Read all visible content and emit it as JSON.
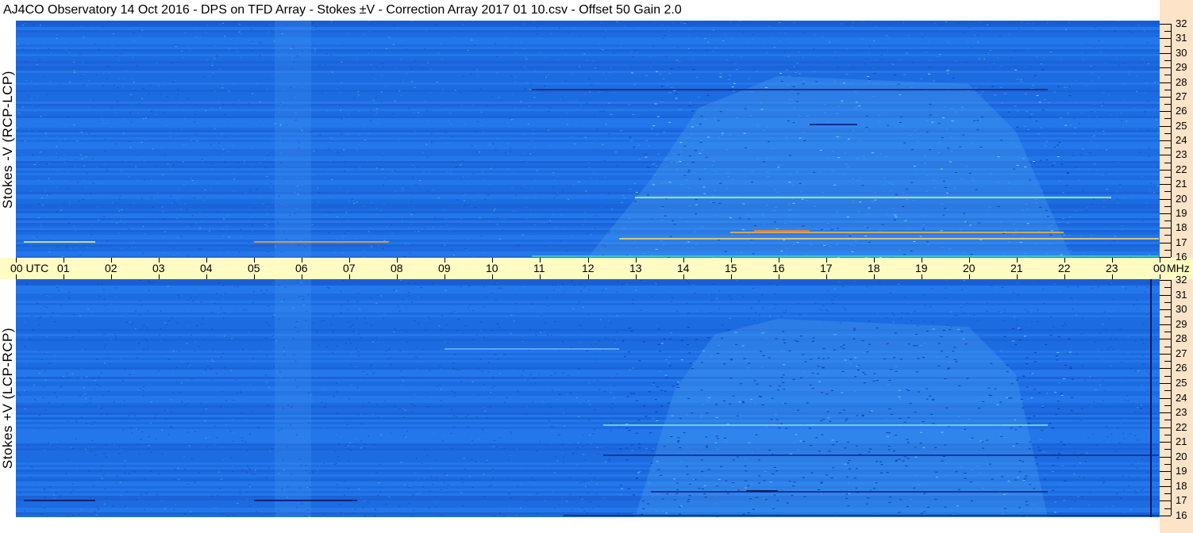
{
  "title": "AJ4CO Observatory  14 Oct 2016  -  DPS on TFD Array  -  Stokes ±V  -  Correction Array 2017 01 10.csv  -  Offset 50  Gain 2.0",
  "panels": {
    "top_label": "Stokes -V (RCP-LCP)",
    "bottom_label": "Stokes +V (LCP-RCP)"
  },
  "time_axis": {
    "labels": [
      "00  UTC",
      "01",
      "02",
      "03",
      "04",
      "05",
      "06",
      "07",
      "08",
      "09",
      "10",
      "11",
      "12",
      "13",
      "14",
      "15",
      "16",
      "17",
      "18",
      "19",
      "20",
      "21",
      "22",
      "23",
      "00"
    ],
    "unit": "MHz"
  },
  "freq_axis": {
    "labels": [
      "32",
      "31",
      "30",
      "29",
      "28",
      "27",
      "26",
      "25",
      "24",
      "23",
      "22",
      "21",
      "20",
      "19",
      "18",
      "17",
      "16"
    ]
  },
  "colors": {
    "background": "#1f6fe6",
    "timebar": "#fffbc3",
    "freqbar": "#fde3c8"
  }
}
